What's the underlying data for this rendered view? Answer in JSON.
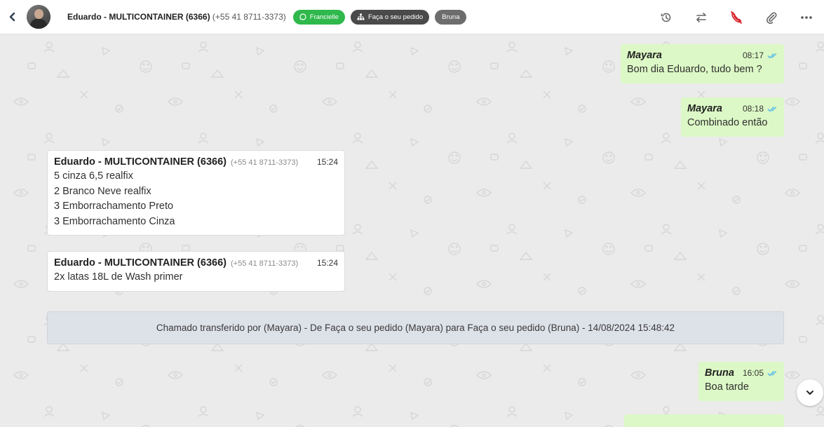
{
  "header": {
    "contact_name": "Eduardo - MULTICONTAINER (6366)",
    "contact_phone": "(+55 41 8711-3373)",
    "tags": [
      {
        "label": "Francielle",
        "color": "#2fb84b",
        "icon": "whatsapp-icon"
      },
      {
        "label": "Faça o seu pedido",
        "color": "#4a4a4a",
        "icon": "sitemap-icon"
      },
      {
        "label": "Bruna",
        "color": "#6d6d6d"
      }
    ],
    "actions": [
      "history-icon",
      "transfer-icon",
      "end-call-icon",
      "attach-icon",
      "more-icon"
    ]
  },
  "messages": [
    {
      "direction": "out",
      "sender": "Mayara",
      "time": "08:17",
      "lines": [
        "Bom dia Eduardo, tudo bem ?"
      ]
    },
    {
      "direction": "out",
      "sender": "Mayara",
      "time": "08:18",
      "lines": [
        "Combinado então"
      ]
    },
    {
      "direction": "in",
      "sender": "Eduardo - MULTICONTAINER (6366)",
      "phone": "(+55 41 8711-3373)",
      "time": "15:24",
      "lines": [
        "5 cinza 6,5 realfix",
        "2 Branco Neve realfix",
        "3 Emborrachamento Preto",
        "3 Emborrachamento Cinza"
      ]
    },
    {
      "direction": "in",
      "sender": "Eduardo - MULTICONTAINER (6366)",
      "phone": "(+55 41 8711-3373)",
      "time": "15:24",
      "lines": [
        "2x latas 18L de Wash primer"
      ]
    },
    {
      "direction": "out",
      "sender": "Bruna",
      "time": "16:05",
      "lines": [
        "Boa tarde"
      ]
    }
  ],
  "system_message": "Chamado transferido por (Mayara) - De Faça o seu pedido (Mayara) para Faça o seu pedido (Bruna) - 14/08/2024 15:48:42",
  "colors": {
    "outgoing_bubble": "#dcf8c6",
    "incoming_bubble": "#ffffff",
    "read_ticks": "#4fb6ec",
    "end_call": "#d9232a"
  }
}
